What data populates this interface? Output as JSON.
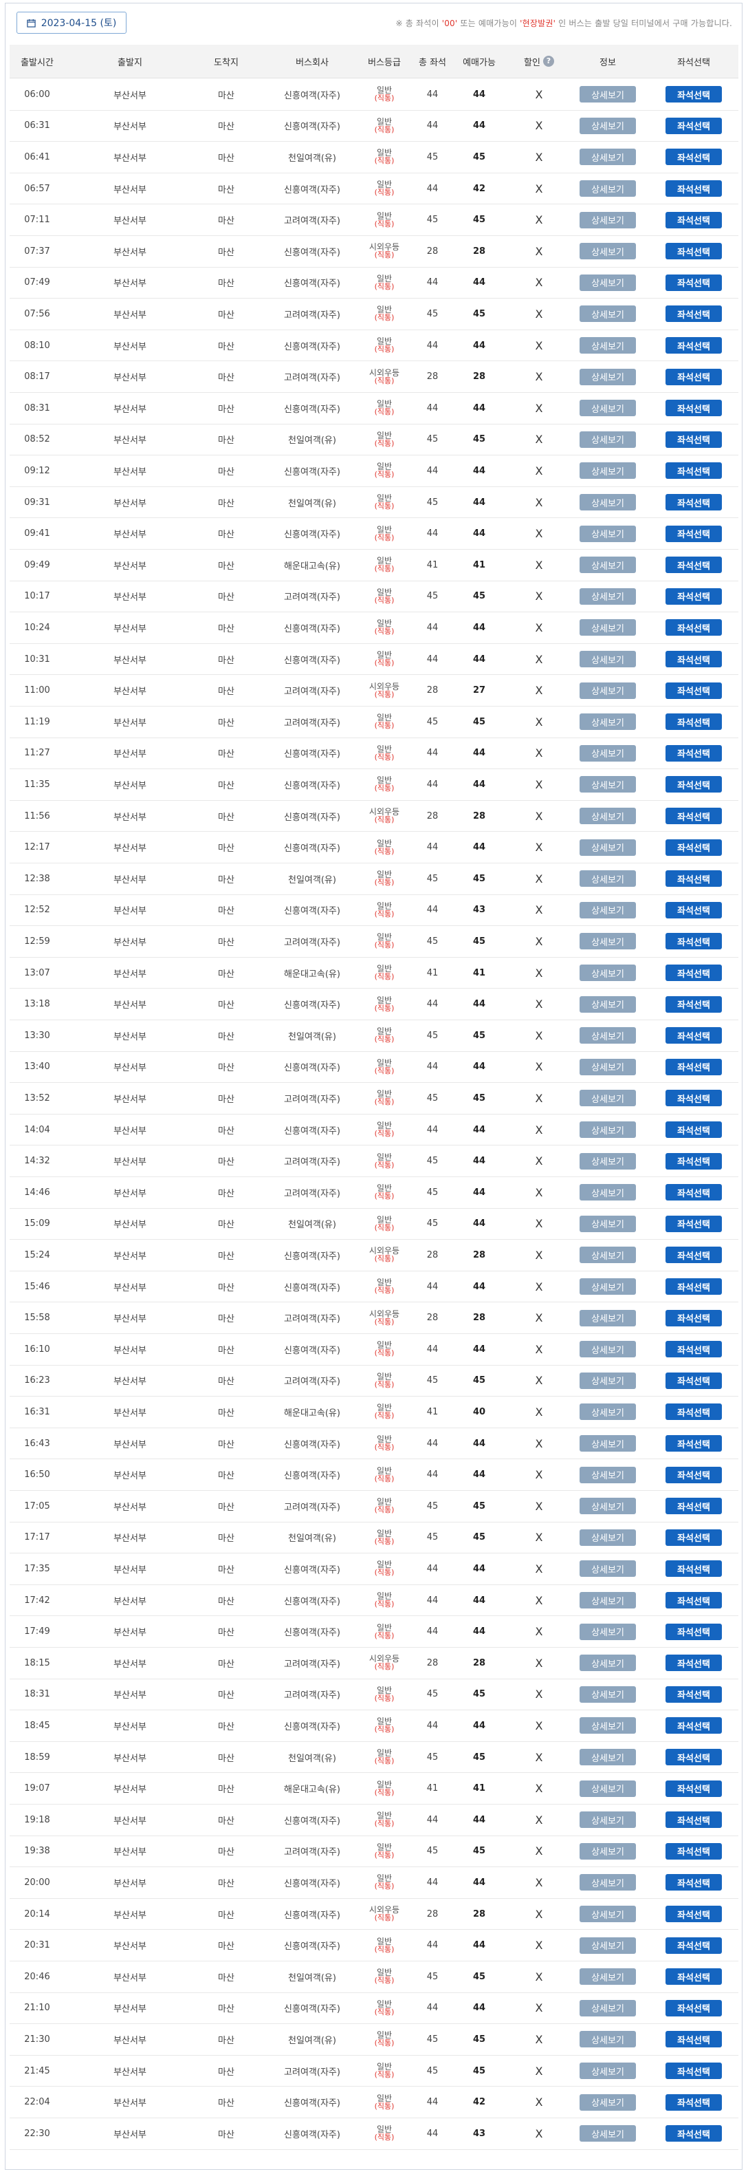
{
  "date_button": {
    "label": "2023-04-15 (토)"
  },
  "notice": {
    "prefix": "※ 총 좌석이 ",
    "zero": "'00'",
    "middle": " 또는 예매가능이 ",
    "onsite": "'현장발권'",
    "suffix": " 인 버스는 출발 당일 터미널에서 구매 가능합니다."
  },
  "columns": {
    "time": "출발시간",
    "origin": "출발지",
    "destination": "도착지",
    "company": "버스회사",
    "grade": "버스등급",
    "total": "총 좌석",
    "available": "예매가능",
    "discount": "할인",
    "info": "정보",
    "seat": "좌석선택"
  },
  "row_defaults": {
    "origin": "부산서부",
    "destination": "마산",
    "discount": "X",
    "info_label": "상세보기",
    "seat_label": "좌석선택",
    "grade_paren": "(직통)"
  },
  "rows": [
    {
      "time": "06:00",
      "company": "신흥여객(자주)",
      "grade": "일반",
      "total": "44",
      "available": "44"
    },
    {
      "time": "06:31",
      "company": "신흥여객(자주)",
      "grade": "일반",
      "total": "44",
      "available": "44"
    },
    {
      "time": "06:41",
      "company": "천일여객(유)",
      "grade": "일반",
      "total": "45",
      "available": "45"
    },
    {
      "time": "06:57",
      "company": "신흥여객(자주)",
      "grade": "일반",
      "total": "44",
      "available": "42"
    },
    {
      "time": "07:11",
      "company": "고려여객(자주)",
      "grade": "일반",
      "total": "45",
      "available": "45"
    },
    {
      "time": "07:37",
      "company": "신흥여객(자주)",
      "grade": "시외우등",
      "total": "28",
      "available": "28"
    },
    {
      "time": "07:49",
      "company": "신흥여객(자주)",
      "grade": "일반",
      "total": "44",
      "available": "44"
    },
    {
      "time": "07:56",
      "company": "고려여객(자주)",
      "grade": "일반",
      "total": "45",
      "available": "45"
    },
    {
      "time": "08:10",
      "company": "신흥여객(자주)",
      "grade": "일반",
      "total": "44",
      "available": "44"
    },
    {
      "time": "08:17",
      "company": "고려여객(자주)",
      "grade": "시외우등",
      "total": "28",
      "available": "28"
    },
    {
      "time": "08:31",
      "company": "신흥여객(자주)",
      "grade": "일반",
      "total": "44",
      "available": "44"
    },
    {
      "time": "08:52",
      "company": "천일여객(유)",
      "grade": "일반",
      "total": "45",
      "available": "45"
    },
    {
      "time": "09:12",
      "company": "신흥여객(자주)",
      "grade": "일반",
      "total": "44",
      "available": "44"
    },
    {
      "time": "09:31",
      "company": "천일여객(유)",
      "grade": "일반",
      "total": "45",
      "available": "44"
    },
    {
      "time": "09:41",
      "company": "신흥여객(자주)",
      "grade": "일반",
      "total": "44",
      "available": "44"
    },
    {
      "time": "09:49",
      "company": "해운대고속(유)",
      "grade": "일반",
      "total": "41",
      "available": "41"
    },
    {
      "time": "10:17",
      "company": "고려여객(자주)",
      "grade": "일반",
      "total": "45",
      "available": "45"
    },
    {
      "time": "10:24",
      "company": "신흥여객(자주)",
      "grade": "일반",
      "total": "44",
      "available": "44"
    },
    {
      "time": "10:31",
      "company": "신흥여객(자주)",
      "grade": "일반",
      "total": "44",
      "available": "44"
    },
    {
      "time": "11:00",
      "company": "고려여객(자주)",
      "grade": "시외우등",
      "total": "28",
      "available": "27"
    },
    {
      "time": "11:19",
      "company": "고려여객(자주)",
      "grade": "일반",
      "total": "45",
      "available": "45"
    },
    {
      "time": "11:27",
      "company": "신흥여객(자주)",
      "grade": "일반",
      "total": "44",
      "available": "44"
    },
    {
      "time": "11:35",
      "company": "신흥여객(자주)",
      "grade": "일반",
      "total": "44",
      "available": "44"
    },
    {
      "time": "11:56",
      "company": "신흥여객(자주)",
      "grade": "시외우등",
      "total": "28",
      "available": "28"
    },
    {
      "time": "12:17",
      "company": "신흥여객(자주)",
      "grade": "일반",
      "total": "44",
      "available": "44"
    },
    {
      "time": "12:38",
      "company": "천일여객(유)",
      "grade": "일반",
      "total": "45",
      "available": "45"
    },
    {
      "time": "12:52",
      "company": "신흥여객(자주)",
      "grade": "일반",
      "total": "44",
      "available": "43"
    },
    {
      "time": "12:59",
      "company": "고려여객(자주)",
      "grade": "일반",
      "total": "45",
      "available": "45"
    },
    {
      "time": "13:07",
      "company": "해운대고속(유)",
      "grade": "일반",
      "total": "41",
      "available": "41"
    },
    {
      "time": "13:18",
      "company": "신흥여객(자주)",
      "grade": "일반",
      "total": "44",
      "available": "44"
    },
    {
      "time": "13:30",
      "company": "천일여객(유)",
      "grade": "일반",
      "total": "45",
      "available": "45"
    },
    {
      "time": "13:40",
      "company": "신흥여객(자주)",
      "grade": "일반",
      "total": "44",
      "available": "44"
    },
    {
      "time": "13:52",
      "company": "고려여객(자주)",
      "grade": "일반",
      "total": "45",
      "available": "45"
    },
    {
      "time": "14:04",
      "company": "신흥여객(자주)",
      "grade": "일반",
      "total": "44",
      "available": "44"
    },
    {
      "time": "14:32",
      "company": "고려여객(자주)",
      "grade": "일반",
      "total": "45",
      "available": "44"
    },
    {
      "time": "14:46",
      "company": "고려여객(자주)",
      "grade": "일반",
      "total": "45",
      "available": "44"
    },
    {
      "time": "15:09",
      "company": "천일여객(유)",
      "grade": "일반",
      "total": "45",
      "available": "44"
    },
    {
      "time": "15:24",
      "company": "신흥여객(자주)",
      "grade": "시외우등",
      "total": "28",
      "available": "28"
    },
    {
      "time": "15:46",
      "company": "신흥여객(자주)",
      "grade": "일반",
      "total": "44",
      "available": "44"
    },
    {
      "time": "15:58",
      "company": "고려여객(자주)",
      "grade": "시외우등",
      "total": "28",
      "available": "28"
    },
    {
      "time": "16:10",
      "company": "신흥여객(자주)",
      "grade": "일반",
      "total": "44",
      "available": "44"
    },
    {
      "time": "16:23",
      "company": "고려여객(자주)",
      "grade": "일반",
      "total": "45",
      "available": "45"
    },
    {
      "time": "16:31",
      "company": "해운대고속(유)",
      "grade": "일반",
      "total": "41",
      "available": "40"
    },
    {
      "time": "16:43",
      "company": "신흥여객(자주)",
      "grade": "일반",
      "total": "44",
      "available": "44"
    },
    {
      "time": "16:50",
      "company": "신흥여객(자주)",
      "grade": "일반",
      "total": "44",
      "available": "44"
    },
    {
      "time": "17:05",
      "company": "고려여객(자주)",
      "grade": "일반",
      "total": "45",
      "available": "45"
    },
    {
      "time": "17:17",
      "company": "천일여객(유)",
      "grade": "일반",
      "total": "45",
      "available": "45"
    },
    {
      "time": "17:35",
      "company": "신흥여객(자주)",
      "grade": "일반",
      "total": "44",
      "available": "44"
    },
    {
      "time": "17:42",
      "company": "신흥여객(자주)",
      "grade": "일반",
      "total": "44",
      "available": "44"
    },
    {
      "time": "17:49",
      "company": "신흥여객(자주)",
      "grade": "일반",
      "total": "44",
      "available": "44"
    },
    {
      "time": "18:15",
      "company": "고려여객(자주)",
      "grade": "시외우등",
      "total": "28",
      "available": "28"
    },
    {
      "time": "18:31",
      "company": "고려여객(자주)",
      "grade": "일반",
      "total": "45",
      "available": "45"
    },
    {
      "time": "18:45",
      "company": "신흥여객(자주)",
      "grade": "일반",
      "total": "44",
      "available": "44"
    },
    {
      "time": "18:59",
      "company": "천일여객(유)",
      "grade": "일반",
      "total": "45",
      "available": "45"
    },
    {
      "time": "19:07",
      "company": "해운대고속(유)",
      "grade": "일반",
      "total": "41",
      "available": "41"
    },
    {
      "time": "19:18",
      "company": "신흥여객(자주)",
      "grade": "일반",
      "total": "44",
      "available": "44"
    },
    {
      "time": "19:38",
      "company": "고려여객(자주)",
      "grade": "일반",
      "total": "45",
      "available": "45"
    },
    {
      "time": "20:00",
      "company": "신흥여객(자주)",
      "grade": "일반",
      "total": "44",
      "available": "44"
    },
    {
      "time": "20:14",
      "company": "신흥여객(자주)",
      "grade": "시외우등",
      "total": "28",
      "available": "28"
    },
    {
      "time": "20:31",
      "company": "신흥여객(자주)",
      "grade": "일반",
      "total": "44",
      "available": "44"
    },
    {
      "time": "20:46",
      "company": "천일여객(유)",
      "grade": "일반",
      "total": "45",
      "available": "45"
    },
    {
      "time": "21:10",
      "company": "신흥여객(자주)",
      "grade": "일반",
      "total": "44",
      "available": "44"
    },
    {
      "time": "21:30",
      "company": "천일여객(유)",
      "grade": "일반",
      "total": "45",
      "available": "45"
    },
    {
      "time": "21:45",
      "company": "고려여객(자주)",
      "grade": "일반",
      "total": "45",
      "available": "45"
    },
    {
      "time": "22:04",
      "company": "신흥여객(자주)",
      "grade": "일반",
      "total": "44",
      "available": "42"
    },
    {
      "time": "22:30",
      "company": "신흥여객(자주)",
      "grade": "일반",
      "total": "44",
      "available": "43"
    }
  ]
}
